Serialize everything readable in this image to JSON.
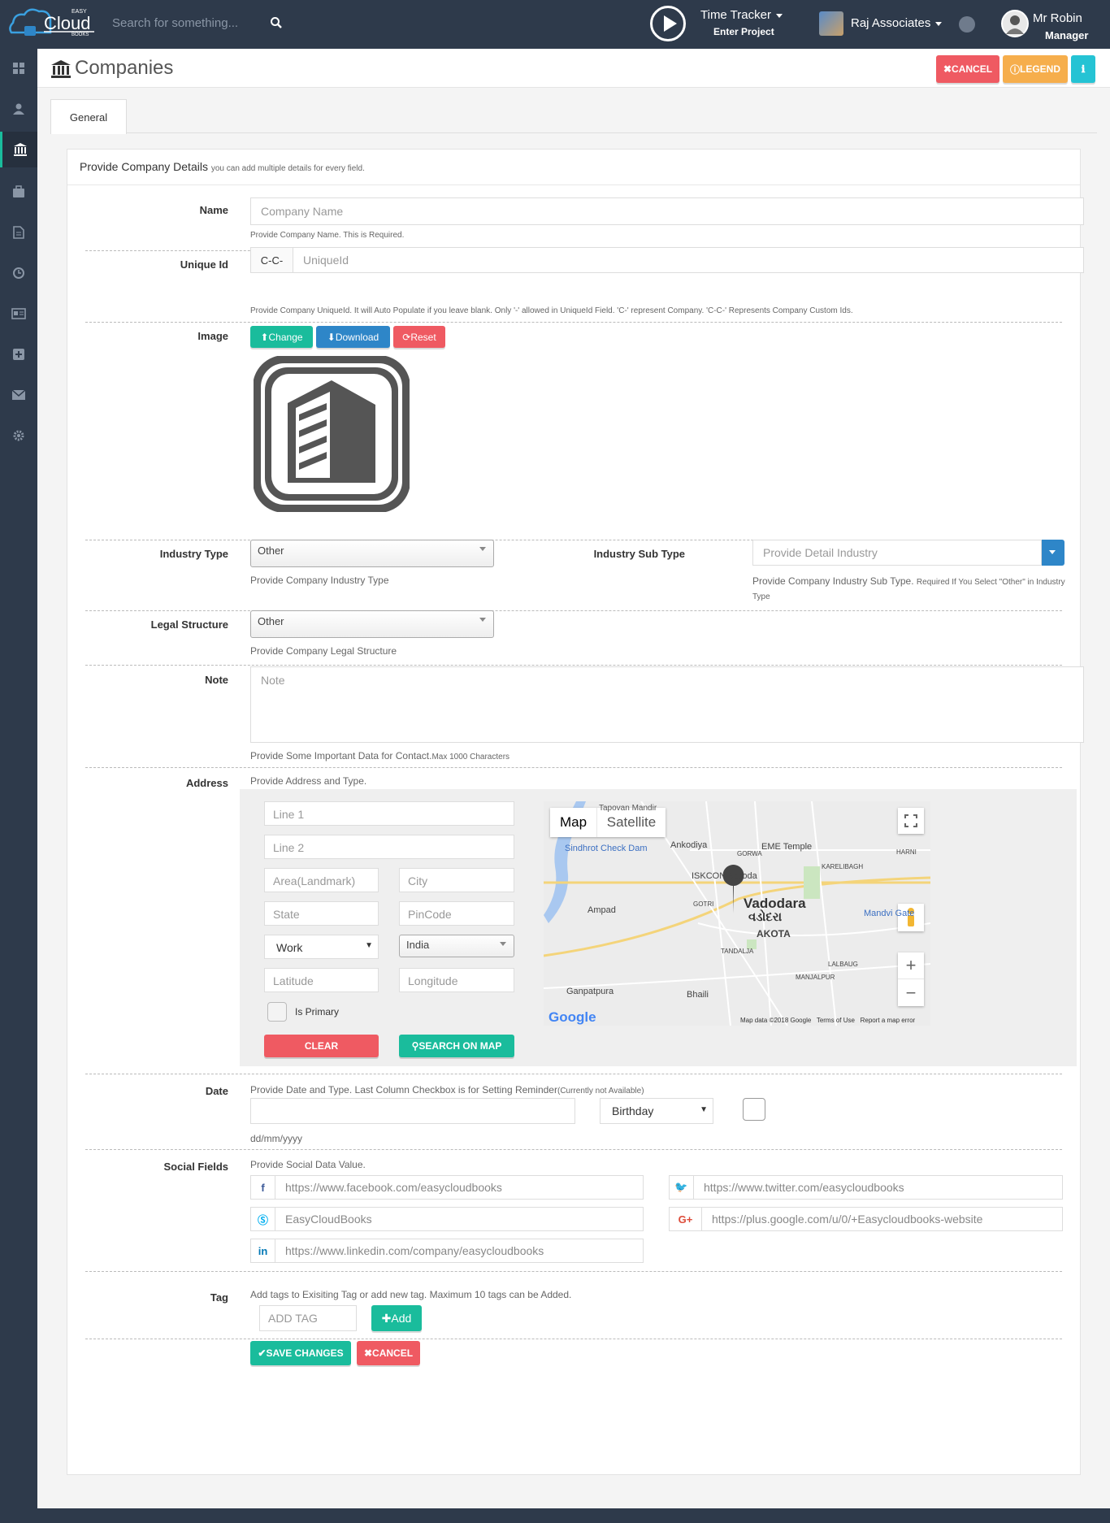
{
  "topbar": {
    "logo_text": "Cloud",
    "logo_easy": "EASY",
    "logo_books": "BOOKS",
    "search_placeholder": "Search for something...",
    "time_tracker_label": "Time Tracker",
    "time_tracker_sub": "Enter Project",
    "company_name": "Raj Associates",
    "user_name": "Mr Robin",
    "user_role": "Manager"
  },
  "sidebar": {
    "items": [
      "dashboard-icon",
      "user-icon",
      "bank-icon",
      "briefcase-icon",
      "document-icon",
      "clock-icon",
      "card-icon",
      "plus-square-icon",
      "envelope-icon",
      "gear-icon"
    ],
    "active_index": 2
  },
  "header": {
    "title": "Companies",
    "cancel_label": "CANCEL",
    "legend_label": "LEGEND"
  },
  "tabs": [
    {
      "label": "General"
    }
  ],
  "form": {
    "heading": "Provide Company Details",
    "heading_note": "you can add multiple details for every field.",
    "name": {
      "label": "Name",
      "placeholder": "Company Name",
      "hint": "Provide Company Name. This is Required."
    },
    "unique_id": {
      "label": "Unique Id",
      "prefix": "C-C-",
      "placeholder": "UniqueId",
      "hint": "Provide Company UniqueId. It will Auto Populate if you leave blank. Only '-' allowed in UniqueId Field. 'C-' represent Company. 'C-C-' Represents Company Custom Ids."
    },
    "image": {
      "label": "Image",
      "change_label": "Change",
      "download_label": "Download",
      "reset_label": "Reset"
    },
    "industry_type": {
      "label": "Industry Type",
      "value": "Other",
      "hint": "Provide Company Industry Type"
    },
    "industry_sub_type": {
      "label": "Industry Sub Type",
      "placeholder": "Provide Detail Industry",
      "hint": "Provide Company Industry Sub Type.",
      "hint_small": "Required If You Select \"Other\" in Industry Type"
    },
    "legal_structure": {
      "label": "Legal Structure",
      "value": "Other",
      "hint": "Provide Company Legal Structure"
    },
    "note": {
      "label": "Note",
      "placeholder": "Note",
      "hint": "Provide Some Important Data for Contact.",
      "hint_small": "Max 1000 Characters"
    },
    "address": {
      "label": "Address",
      "hint": "Provide Address and Type.",
      "line1": "Line 1",
      "line2": "Line 2",
      "area": "Area(Landmark)",
      "city": "City",
      "state": "State",
      "pincode": "PinCode",
      "type_value": "Work",
      "country_value": "India",
      "latitude": "Latitude",
      "longitude": "Longitude",
      "primary_label": "Is Primary",
      "clear_label": "CLEAR",
      "search_map_label": "SEARCH ON MAP"
    },
    "map": {
      "map_tab": "Map",
      "satellite_tab": "Satellite",
      "places": [
        "Tapovan Mandir",
        "Sindhrot Check Dam",
        "Ankodiya",
        "EME Temple",
        "ISKCON Baroda",
        "Vadodara",
        "વડોદરા",
        "Ampad",
        "AKOTA",
        "Mandvi Gate",
        "TANDALJA",
        "LALBAUG",
        "MANJALPUR",
        "Ganpatpura",
        "Bhaili",
        "GORWA",
        "HARNI",
        "KARELIBAGH",
        "GOTRI"
      ],
      "footer": "Map data ©2018 Google   Terms of Use   Report a map error",
      "google": "Google"
    },
    "date": {
      "label": "Date",
      "hint": "Provide Date and Type. Last Column Checkbox is for Setting Reminder",
      "hint_small": "(Currently not Available)",
      "type_value": "Birthday",
      "format_hint": "dd/mm/yyyy"
    },
    "social": {
      "label": "Social Fields",
      "hint": "Provide Social Data Value.",
      "facebook": "https://www.facebook.com/easycloudbooks",
      "twitter": "https://www.twitter.com/easycloudbooks",
      "skype": "EasyCloudBooks",
      "google_plus": "https://plus.google.com/u/0/+Easycloudbooks-website",
      "linkedin": "https://www.linkedin.com/company/easycloudbooks"
    },
    "tag": {
      "label": "Tag",
      "hint": "Add tags to Exisiting Tag or add new tag. Maximum 10 tags can be Added.",
      "placeholder": "ADD TAG",
      "add_label": "Add"
    },
    "save_label": "SAVE CHANGES",
    "cancel_label": "CANCEL"
  },
  "colors": {
    "topbar": "#2e3a4b",
    "teal": "#1abc9c",
    "blue": "#2e86c8",
    "red": "#ef5a62",
    "orange": "#f6ae4c",
    "cyan": "#25c3d4"
  }
}
